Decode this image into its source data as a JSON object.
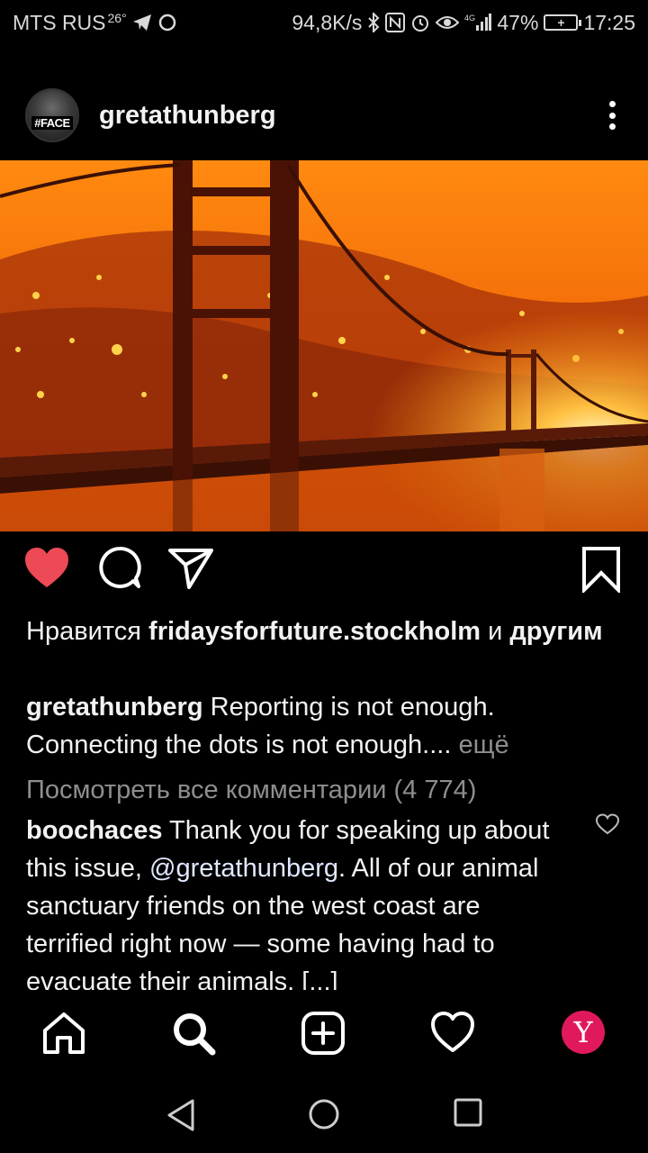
{
  "status_bar": {
    "carrier": "MTS RUS",
    "temperature": "26°",
    "speed": "94,8K/s",
    "network": "4G",
    "battery": "47%",
    "time": "17:25"
  },
  "post": {
    "username": "gretathunberg",
    "avatar_tag": "#FACE",
    "image_description_icon": "burning-bridge-photo",
    "likes": {
      "prefix": "Нравится",
      "user": "fridaysforfuture.stockholm",
      "suffix": "и",
      "others": "другим"
    },
    "caption": {
      "user": "gretathunberg",
      "text": "Reporting is not enough. Connecting the dots is not enough....",
      "more": "ещё"
    },
    "view_comments": "Посмотреть все комментарии (4 774)",
    "comment": {
      "user": "boochaces",
      "text_before": "Thank you for speaking up about this issue,",
      "mention": "@gretathunberg",
      "text_after": ". All of our animal sanctuary friends on the west coast are terrified right now — some having had to evacuate their animals. [...]"
    }
  },
  "colors": {
    "like_active": "#ed4956",
    "profile_badge": "#e0195c",
    "muted_text": "#8e8e8e"
  },
  "nav": {
    "profile_letter": "Y"
  }
}
